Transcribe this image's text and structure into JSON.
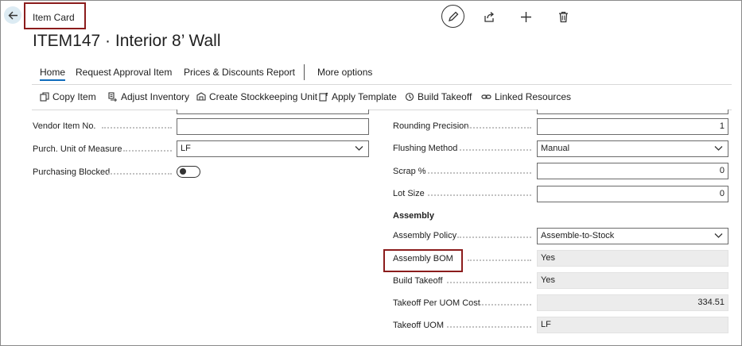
{
  "page": {
    "caption": "Item Card",
    "title": "ITEM147 · Interior 8’ Wall"
  },
  "tabs": [
    {
      "label": "Home"
    },
    {
      "label": "Request Approval"
    },
    {
      "label": "Item"
    },
    {
      "label": "Prices & Discounts"
    },
    {
      "label": "Report"
    },
    {
      "label": "More options"
    }
  ],
  "actions": [
    {
      "label": "Copy Item",
      "icon": "copy-icon"
    },
    {
      "label": "Adjust Inventory",
      "icon": "adjust-inventory-icon"
    },
    {
      "label": "Create Stockkeeping Unit",
      "icon": "stockkeeping-icon"
    },
    {
      "label": "Apply Template",
      "icon": "template-icon"
    },
    {
      "label": "Build Takeoff",
      "icon": "build-takeoff-icon"
    },
    {
      "label": "Linked Resources",
      "icon": "link-icon"
    }
  ],
  "left_fields": {
    "vendor_item_no": {
      "label": "Vendor Item No.",
      "value": ""
    },
    "purch_uom": {
      "label": "Purch. Unit of Measure",
      "value": "LF"
    },
    "purchasing_blocked": {
      "label": "Purchasing Blocked",
      "value": false
    }
  },
  "right_fields": {
    "rounding_precision": {
      "label": "Rounding Precision",
      "value": "1"
    },
    "flushing_method": {
      "label": "Flushing Method",
      "value": "Manual"
    },
    "scrap": {
      "label": "Scrap %",
      "value": "0"
    },
    "lot_size": {
      "label": "Lot Size",
      "value": "0"
    }
  },
  "assembly": {
    "title": "Assembly",
    "policy": {
      "label": "Assembly Policy",
      "value": "Assemble-to-Stock"
    },
    "bom": {
      "label": "Assembly BOM",
      "value": "Yes"
    },
    "build_takeoff": {
      "label": "Build Takeoff",
      "value": "Yes"
    },
    "takeoff_cost": {
      "label": "Takeoff Per UOM Cost",
      "value": "334.51"
    },
    "takeoff_uom": {
      "label": "Takeoff UOM",
      "value": "LF"
    }
  }
}
